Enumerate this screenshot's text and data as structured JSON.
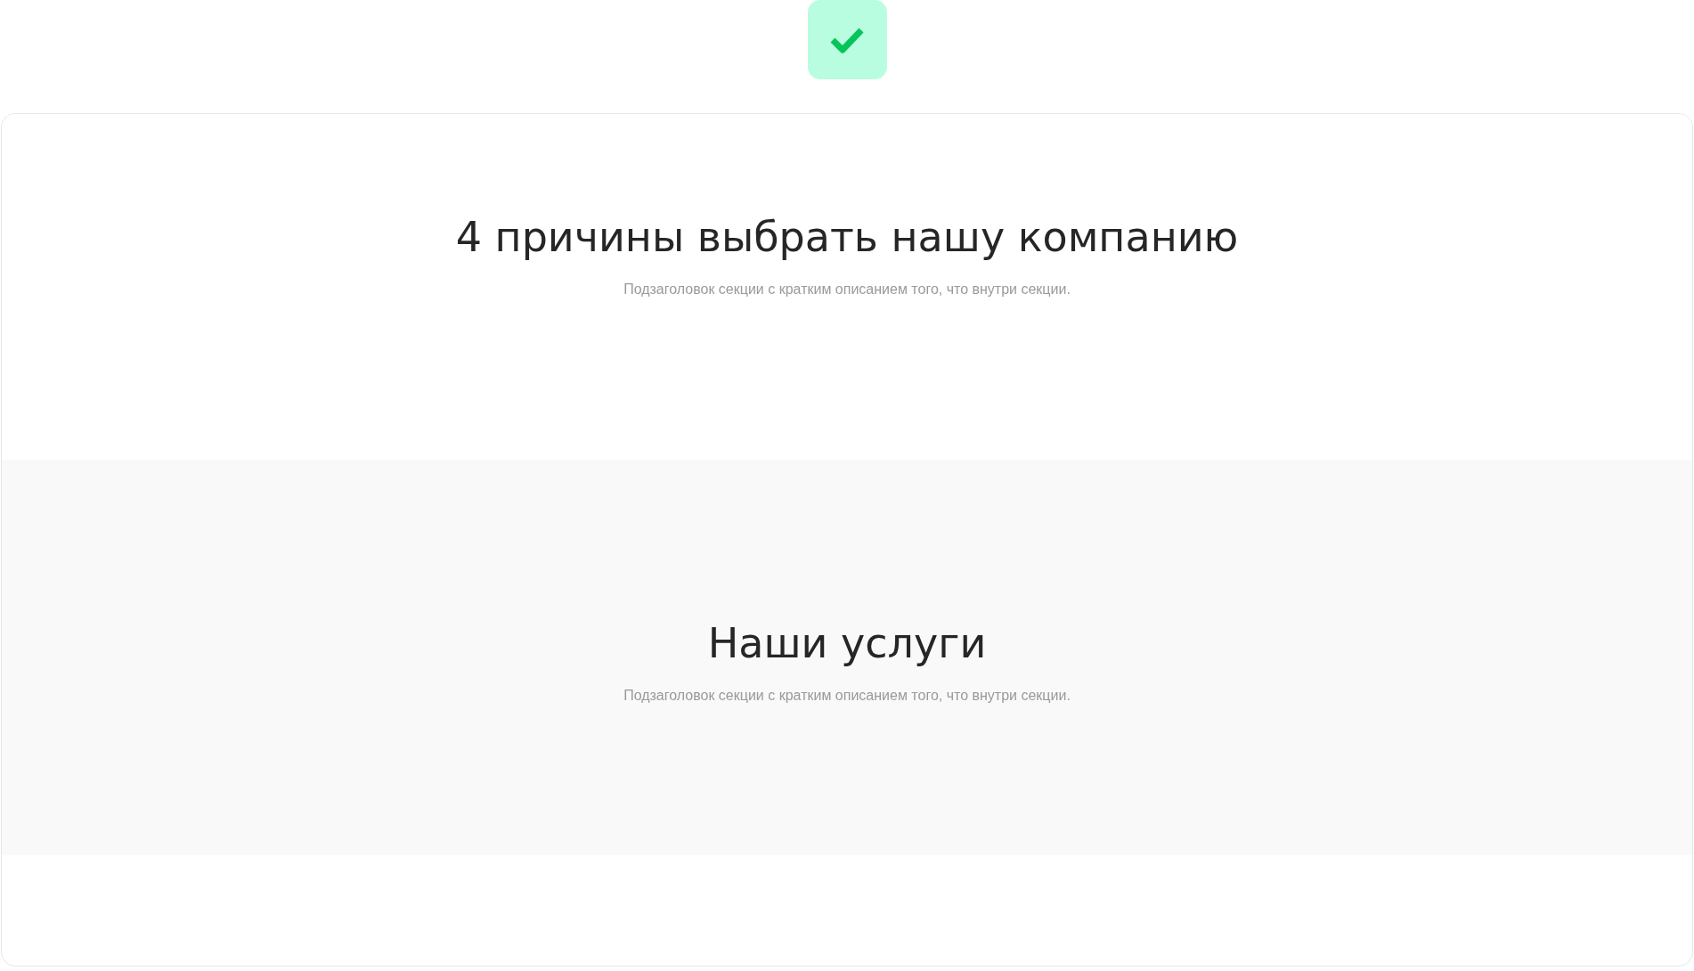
{
  "sections": [
    {
      "title": "4 причины выбрать нашу компанию",
      "subtitle": "Подзаголовок секции с кратким описанием того, что внутри секции.",
      "kind": "plain"
    },
    {
      "title": "Наши услуги",
      "subtitle": "Подзаголовок секции с кратким описанием того, что внутри секции.",
      "kind": "shaded"
    }
  ]
}
